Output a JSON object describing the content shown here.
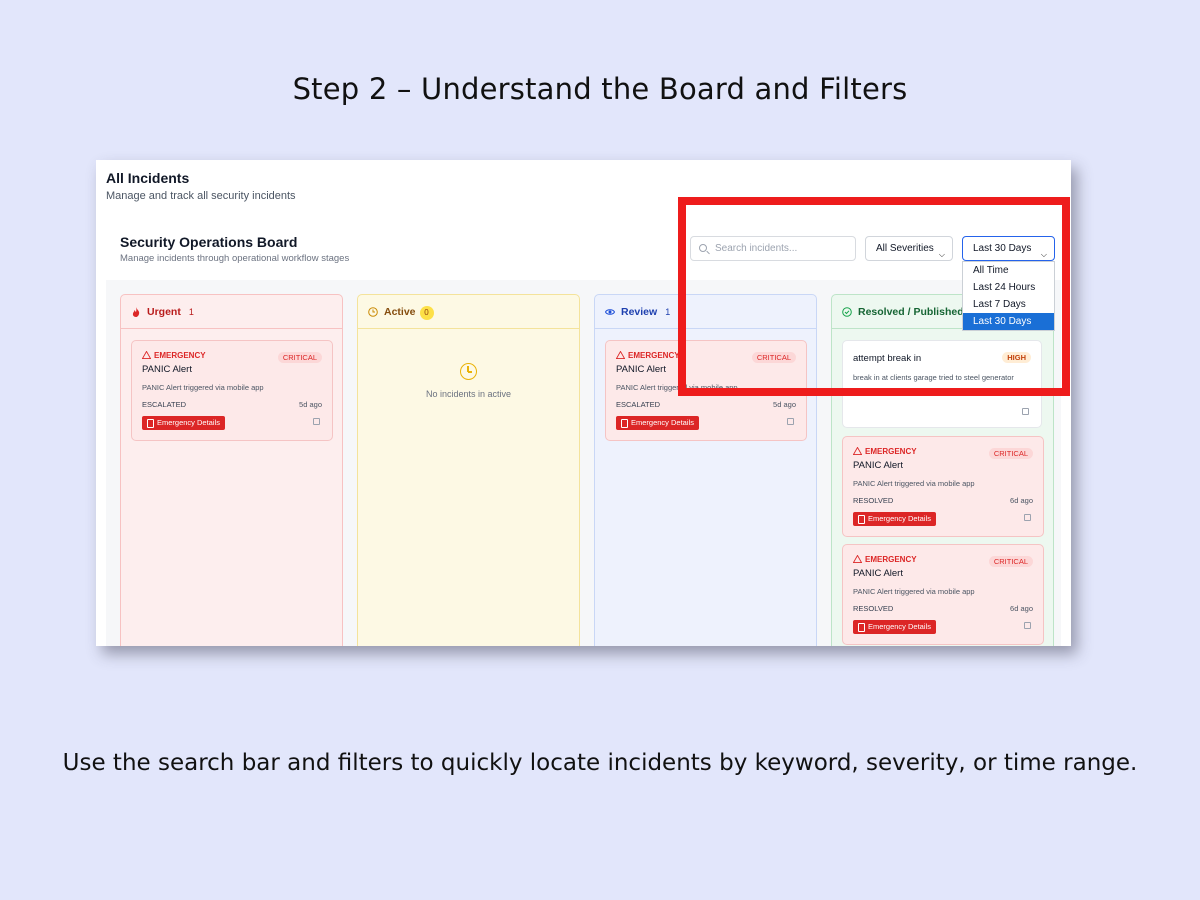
{
  "slide": {
    "title": "Step 2 – Understand the Board and Filters",
    "caption": "Use the search bar and filters to quickly locate incidents by keyword, severity, or time range."
  },
  "page": {
    "title": "All Incidents",
    "subtitle": "Manage and track all security incidents"
  },
  "board": {
    "title": "Security Operations Board",
    "subtitle": "Manage incidents through operational workflow stages",
    "search_placeholder": "Search incidents...",
    "severity_select": "All Severities",
    "time_select": "Last 30 Days",
    "time_options": [
      "All Time",
      "Last 24 Hours",
      "Last 7 Days",
      "Last 30 Days"
    ],
    "selected_time_option": "Last 30 Days"
  },
  "columns": {
    "urgent": {
      "label": "Urgent",
      "count": "1",
      "cards": [
        {
          "type": "EMERGENCY",
          "title": "PANIC Alert",
          "severity": "CRITICAL",
          "desc": "PANIC Alert triggered via mobile app",
          "status": "ESCALATED",
          "age": "5d ago",
          "button": "Emergency Details"
        }
      ]
    },
    "active": {
      "label": "Active",
      "count": "0",
      "empty_text": "No incidents in active"
    },
    "review": {
      "label": "Review",
      "count": "1",
      "cards": [
        {
          "type": "EMERGENCY",
          "title": "PANIC Alert",
          "severity": "CRITICAL",
          "desc": "PANIC Alert triggered via mobile app",
          "status": "ESCALATED",
          "age": "5d ago",
          "button": "Emergency Details"
        }
      ]
    },
    "resolved": {
      "label": "Resolved / Published",
      "top_card": {
        "title": "attempt break in",
        "severity": "HIGH",
        "desc": "break in at clients garage tried to steel generator"
      },
      "cards": [
        {
          "type": "EMERGENCY",
          "title": "PANIC Alert",
          "severity": "CRITICAL",
          "desc": "PANIC Alert triggered via mobile app",
          "status": "RESOLVED",
          "age": "6d ago",
          "button": "Emergency Details"
        },
        {
          "type": "EMERGENCY",
          "title": "PANIC Alert",
          "severity": "CRITICAL",
          "desc": "PANIC Alert triggered via mobile app",
          "status": "RESOLVED",
          "age": "6d ago",
          "button": "Emergency Details"
        }
      ]
    }
  },
  "colors": {
    "highlight": "#ee1c1c",
    "critical": "#dc2626",
    "selected_option": "#1a6fd6",
    "background": "#e2e6fb"
  },
  "icons": [
    "flame-icon",
    "clock-icon",
    "eye-icon",
    "check-circle-icon",
    "search-icon",
    "warning-icon",
    "document-icon",
    "external-link-icon",
    "chevron-down-icon"
  ]
}
